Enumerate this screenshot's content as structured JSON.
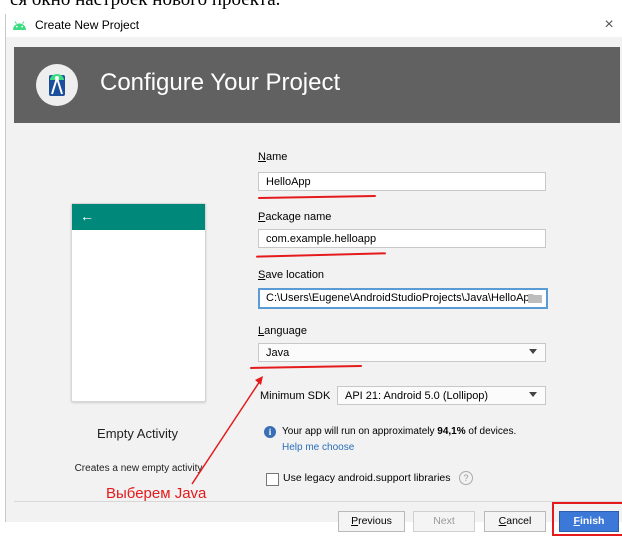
{
  "page_caption": "ся окно настроек нового проекта.",
  "window": {
    "title": "Create New Project",
    "close": "×"
  },
  "banner": {
    "title": "Configure Your Project"
  },
  "preview": {
    "back_arrow": "←",
    "title": "Empty Activity",
    "description": "Creates a new empty activity"
  },
  "form": {
    "name": {
      "label_mnemonic": "N",
      "label_rest": "ame",
      "value": "HelloApp"
    },
    "package": {
      "label_mnemonic": "P",
      "label_rest": "ackage name",
      "value": "com.example.helloapp"
    },
    "location": {
      "label_mnemonic": "S",
      "label_rest": "ave location",
      "value": "C:\\Users\\Eugene\\AndroidStudioProjects\\Java\\HelloAp"
    },
    "language": {
      "label_mnemonic": "L",
      "label_rest": "anguage",
      "value": "Java"
    },
    "min_sdk": {
      "label": "Minimum SDK",
      "value": "API 21: Android 5.0 (Lollipop)"
    },
    "info": {
      "icon": "i",
      "prefix": "Your app will run on approximately ",
      "percent": "94,1%",
      "suffix": " of devices.",
      "help_link": "Help me choose"
    },
    "legacy": {
      "label": "Use legacy android.support libraries",
      "help": "?"
    }
  },
  "annotation": "Выберем Java",
  "buttons": {
    "previous_mnemonic": "P",
    "previous_rest": "revious",
    "next": "Next",
    "cancel_mnemonic": "C",
    "cancel_rest": "ancel",
    "finish_mnemonic": "F",
    "finish_rest": "inish"
  },
  "colors": {
    "banner": "#616161",
    "teal": "#00897b",
    "link": "#2a6ebb",
    "primary": "#3c78d8",
    "annotation": "#e41a1c"
  },
  "icons": [
    "android-logo-icon",
    "close-icon",
    "android-studio-icon",
    "back-arrow-icon",
    "folder-icon",
    "chevron-down-icon",
    "info-icon",
    "help-icon"
  ]
}
